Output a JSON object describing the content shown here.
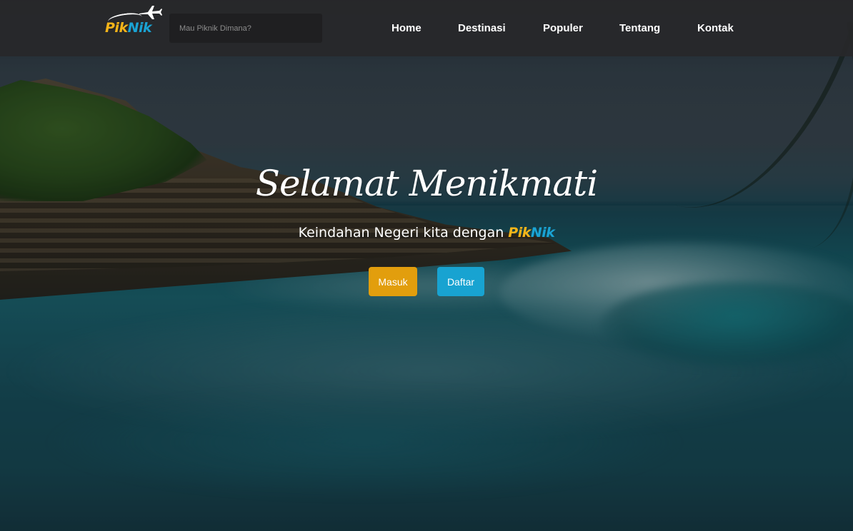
{
  "brand": {
    "name_part1": "Pik",
    "name_part2": "Nik",
    "color_part1": "#f5b419",
    "color_part2": "#1aa3d4",
    "logo_icon": "airplane-icon"
  },
  "search": {
    "placeholder": "Mau Piknik Dimana?"
  },
  "nav": {
    "items": [
      {
        "label": "Home"
      },
      {
        "label": "Destinasi"
      },
      {
        "label": "Populer"
      },
      {
        "label": "Tentang"
      },
      {
        "label": "Kontak"
      }
    ]
  },
  "hero": {
    "title": "Selamat Menikmati",
    "subtitle": "Keindahan Negeri kita dengan",
    "brand_part1": "Pik",
    "brand_part2": "Nik"
  },
  "buttons": {
    "masuk": {
      "label": "Masuk",
      "color": "#e29e0d"
    },
    "daftar": {
      "label": "Daftar",
      "color": "#18a3d1"
    }
  },
  "colors": {
    "navbar_bg": "#28282a",
    "search_bg": "#1f1f21",
    "text": "#ffffff"
  }
}
